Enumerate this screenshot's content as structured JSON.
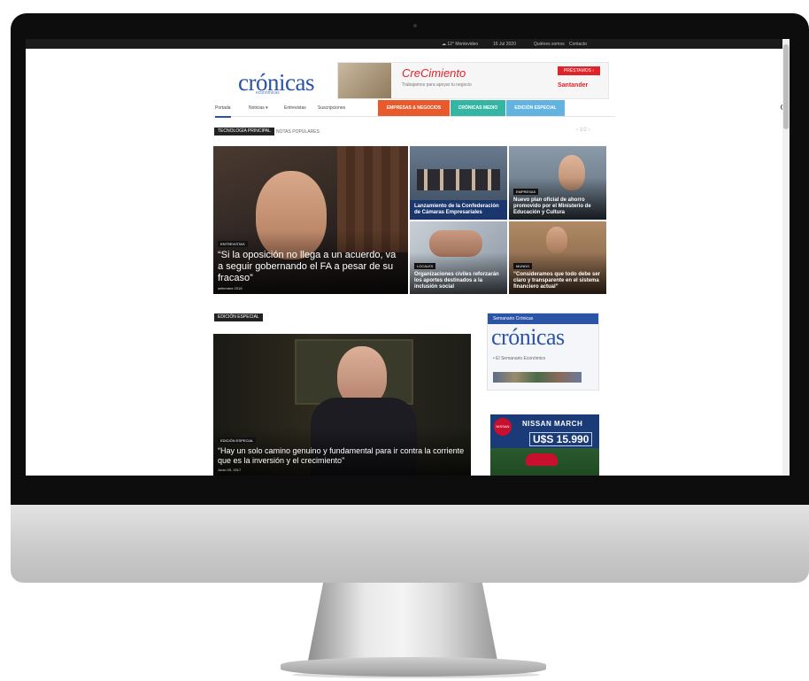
{
  "topbar": {
    "weather": "☁ 12° Montevideo",
    "date": "16 Jul 2020",
    "link1": "Quiénes somos",
    "link2": "Contacto"
  },
  "logo": {
    "name": "crónicas",
    "sub": "económicas"
  },
  "banner": {
    "title": "CreCimiento",
    "tagline": "Trabajamos para apoyar tu negocio",
    "cta": "PRÉSTAMOS ›",
    "brand": "Santander"
  },
  "nav": {
    "items": [
      "Portada",
      "Noticias ▾",
      "Entrevistas",
      "Suscripciones"
    ],
    "pills": [
      {
        "label": "EMPRESAS & NEGOCIOS",
        "color": "#e85a2b"
      },
      {
        "label": "CRÓNICAS MEDIO",
        "color": "#35b6a5"
      },
      {
        "label": "EDICIÓN ESPECIAL",
        "color": "#62b3e0"
      }
    ]
  },
  "section1": {
    "label": "TECNOLOGÍA PRINCIPAL",
    "sub": "NOTAS POPULARES",
    "pager": "‹ 1/2 ›"
  },
  "hero": {
    "category": "ENTREVISTAS",
    "title": "“Si la oposición no llega a un acuerdo, va a seguir gobernando el FA a pesar de su fracaso”",
    "date": "setiembre 2018"
  },
  "tiles": [
    {
      "category": "",
      "title": "Lanzamiento de la Confederación de Cámaras Empresariales"
    },
    {
      "category": "EMPRESAS",
      "title": "Nuevo plan oficial de ahorro promovido por el Ministerio de Educación y Cultura"
    },
    {
      "category": "LOCALES",
      "title": "Organizaciones civiles reforzarán los aportes destinados a la inclusión social"
    },
    {
      "category": "MUNDO",
      "title": "“Consideramos que todo debe ser claro y transparente en el sistema financiero actual”"
    }
  ],
  "section2": {
    "label": "EDICIÓN ESPECIAL"
  },
  "feature": {
    "category": "EDICIÓN ESPECIAL",
    "title": "“Hay un solo camino genuino y fundamental para ir contra la corriente que es la inversión y el crecimiento”",
    "date": "Junio 09, 2017"
  },
  "ad1": {
    "top": "Semanario Crónicas",
    "logo": "crónicas",
    "tag": "• El Semanario Económico"
  },
  "ad2": {
    "title": "NISSAN MARCH",
    "price": "U$S 15.990",
    "badge": "NISSAN"
  }
}
